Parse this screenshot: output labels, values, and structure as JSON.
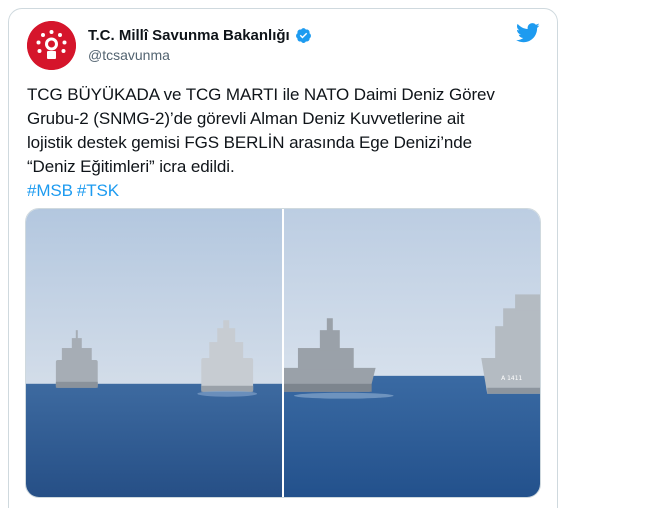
{
  "account": {
    "display_name": "T.C. Millî Savunma Bakanlığı",
    "handle": "@tcsavunma"
  },
  "tweet": {
    "lines": [
      "TCG BÜYÜKADA ve TCG MARTI ile NATO Daimi Deniz Görev",
      "Grubu-2 (SNMG-2)’de görevli Alman Deniz Kuvvetlerine ait",
      "lojistik destek gemisi FGS BERLİN arasında Ege Denizi’nde",
      "“Deniz Eğitimleri” icra edildi."
    ],
    "hashtags": [
      "#MSB",
      "#TSK"
    ]
  },
  "media": {
    "photos": [
      {
        "icon": "ships-photo"
      },
      {
        "icon": "ships-photo",
        "hull_number": "A 1411"
      }
    ]
  },
  "colors": {
    "accent": "#1d9bf0",
    "avatar_red": "#d5152b",
    "sea": "#2f5f98",
    "sky": "#c4d3e6"
  }
}
